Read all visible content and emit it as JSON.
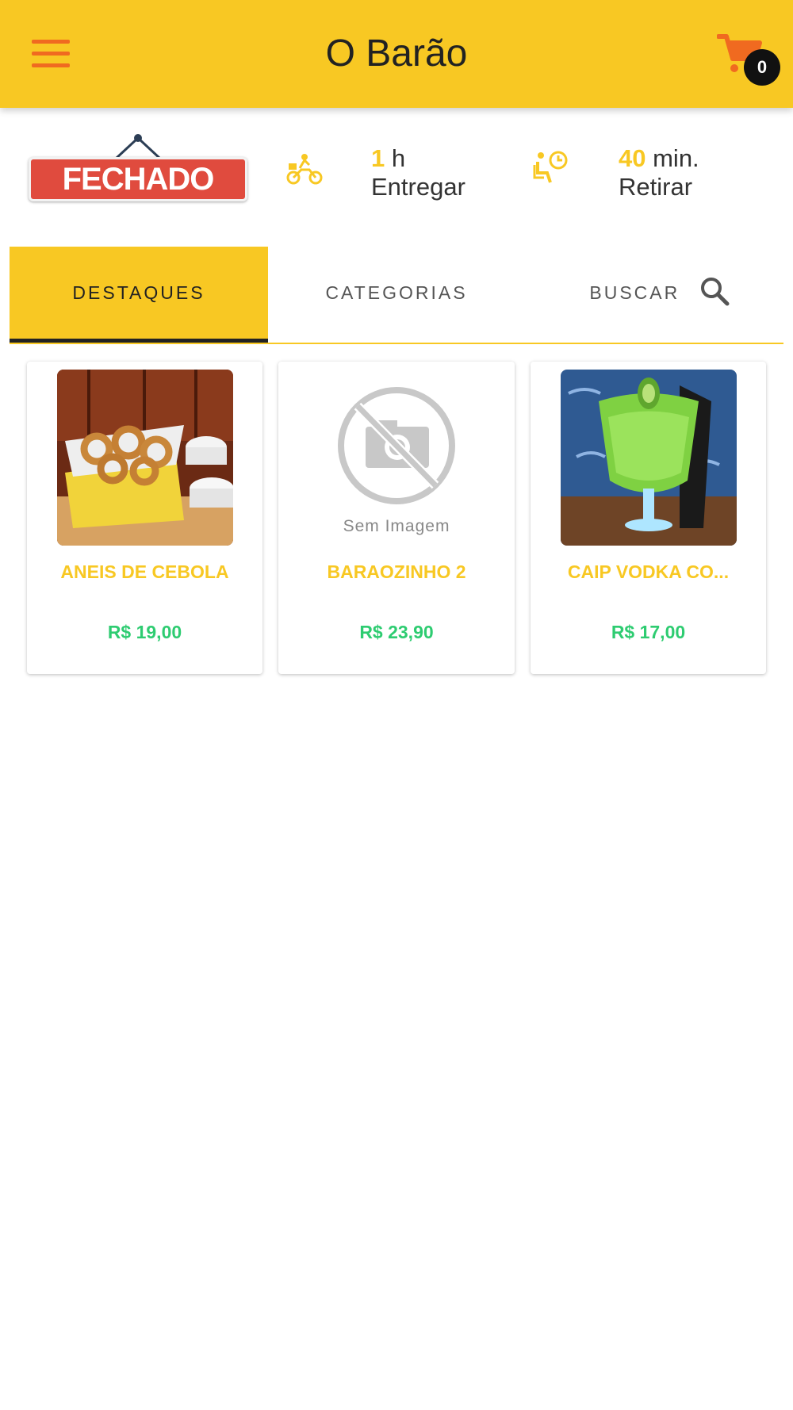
{
  "header": {
    "title": "O Barão",
    "cart_count": "0"
  },
  "status": {
    "sign_label": "FECHADO"
  },
  "delivery": {
    "value": "1",
    "unit": "h",
    "label": "Entregar"
  },
  "pickup": {
    "value": "40",
    "unit": "min.",
    "label": "Retirar"
  },
  "tabs": [
    {
      "label": "DESTAQUES",
      "active": true
    },
    {
      "label": "CATEGORIAS",
      "active": false
    },
    {
      "label": "BUSCAR",
      "active": false
    }
  ],
  "products": [
    {
      "name": "ANEIS DE CEBOLA",
      "price": "R$ 19,00"
    },
    {
      "name": "BARAOZINHO 2",
      "price": "R$ 23,90",
      "image_placeholder": "Sem Imagem"
    },
    {
      "name": "CAIP VODKA CO...",
      "price": "R$ 17,00"
    }
  ],
  "colors": {
    "brand_yellow": "#f8c823",
    "accent_orange": "#f06a20",
    "price_green": "#2ecc71",
    "closed_red": "#e04b3e"
  },
  "icons": [
    "menu-icon",
    "cart-icon",
    "delivery-moto-icon",
    "pickup-clock-icon",
    "search-icon",
    "no-image-camera-icon"
  ]
}
